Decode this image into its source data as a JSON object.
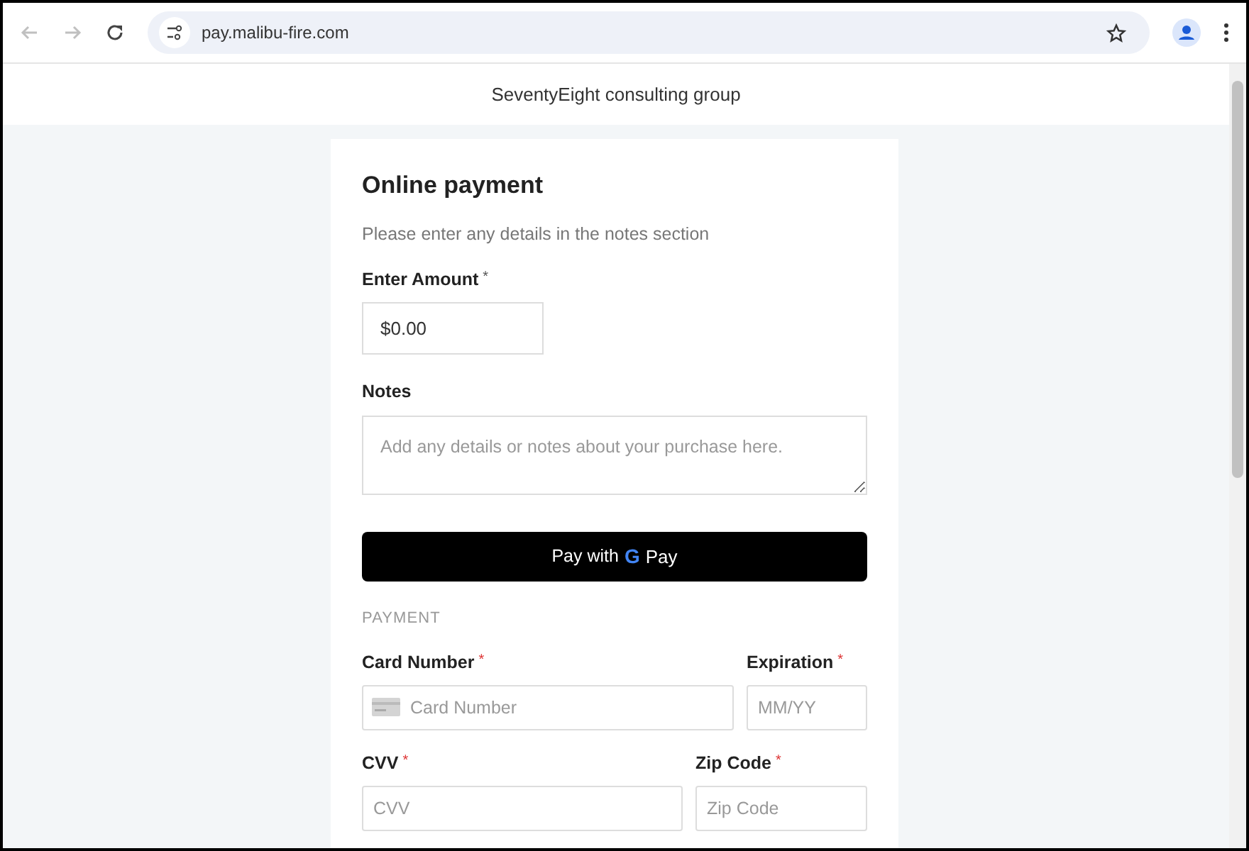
{
  "browser": {
    "url": "pay.malibu-fire.com"
  },
  "header": {
    "title": "SeventyEight consulting group"
  },
  "form": {
    "title": "Online payment",
    "intro": "Please enter any details in the notes section",
    "amount": {
      "label": "Enter Amount",
      "required_mark": "*",
      "value": "$0.00"
    },
    "notes": {
      "label": "Notes",
      "placeholder": "Add any details or notes about your purchase here."
    },
    "gpay_button": {
      "prefix": "Pay with",
      "logo_letter": "G",
      "suffix": "Pay"
    },
    "section": "PAYMENT",
    "rows": [
      [
        {
          "label": "Card Number",
          "required_mark": "*",
          "placeholder": "Card Number",
          "kind": "card"
        },
        {
          "label": "Expiration",
          "required_mark": "*",
          "placeholder": "MM/YY",
          "kind": "plain"
        }
      ],
      [
        {
          "label": "CVV",
          "required_mark": "*",
          "placeholder": "CVV",
          "kind": "plain"
        },
        {
          "label": "Zip Code",
          "required_mark": "*",
          "placeholder": "Zip Code",
          "kind": "plain"
        }
      ]
    ]
  }
}
